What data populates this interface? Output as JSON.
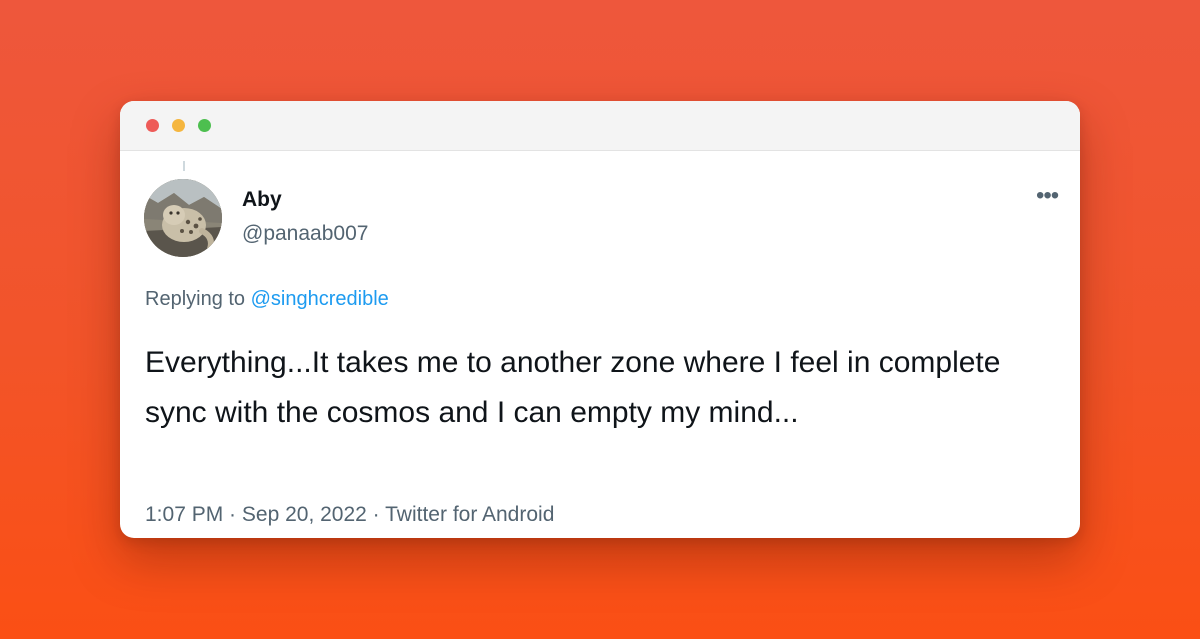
{
  "window": {
    "controls": [
      "close",
      "minimize",
      "maximize"
    ]
  },
  "tweet": {
    "author": {
      "name": "Aby",
      "handle": "@panaab007"
    },
    "replying_to_prefix": "Replying to ",
    "replying_to_handle": "@singhcredible",
    "text": "Everything...It takes me to another zone where I feel in complete sync with the cosmos and I can empty my mind...",
    "time": "1:07 PM",
    "date": "Sep 20, 2022",
    "source": "Twitter for Android",
    "separator": " · ",
    "more_icon": "•••"
  },
  "colors": {
    "background_top": "#ee573c",
    "background_bottom": "#fb4f14",
    "link": "#1d9bf0",
    "text_primary": "#0f1419",
    "text_secondary": "#536471",
    "close": "#ee5b58",
    "minimize": "#f5b63f",
    "maximize": "#4dbf4f"
  }
}
